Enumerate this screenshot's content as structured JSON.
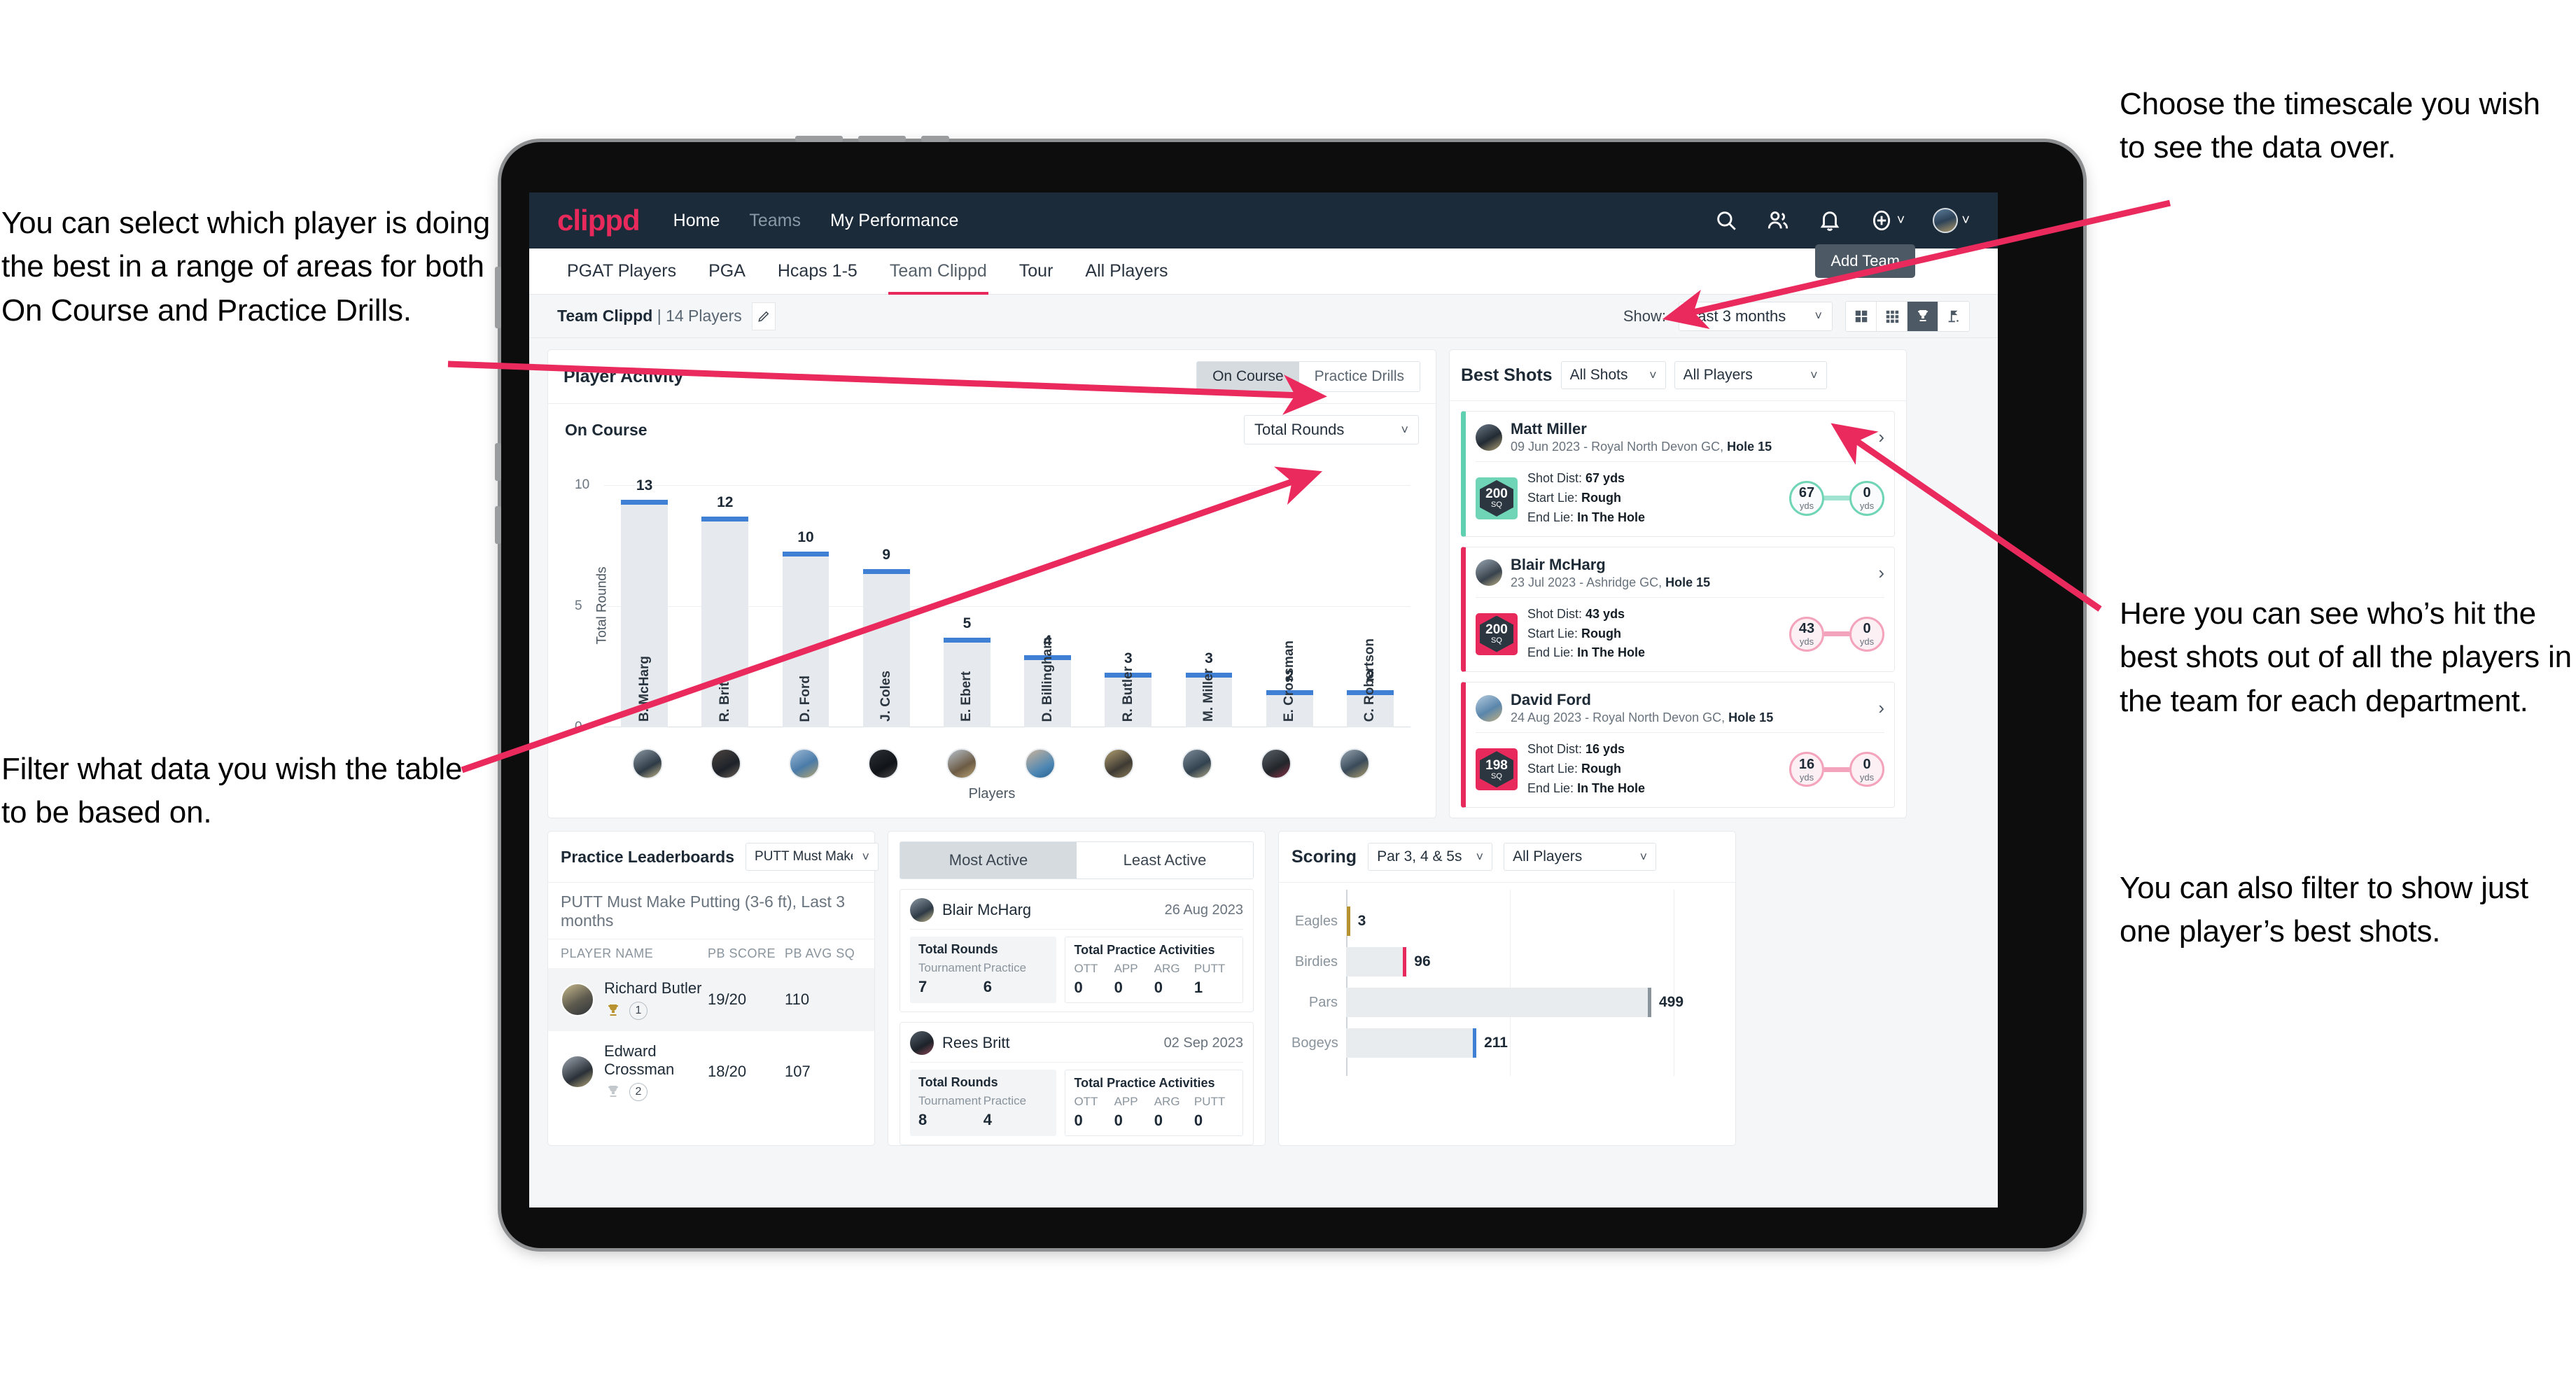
{
  "annotations": {
    "left_top": "You can select which player is doing the best in a range of areas for both On Course and Practice Drills.",
    "left_bottom": "Filter what data you wish the table to be based on.",
    "right_top": "Choose the timescale you wish to see the data over.",
    "right_middle": "Here you can see who’s hit the best shots out of all the players in the team for each department.",
    "right_bottom": "You can also filter to show just one player’s best shots."
  },
  "topnav": {
    "logo": "clippd",
    "links": [
      {
        "label": "Home",
        "active": true
      },
      {
        "label": "Teams",
        "active": false
      },
      {
        "label": "My Performance",
        "active": true
      }
    ],
    "icons": [
      "search-icon",
      "people-icon",
      "bell-icon",
      "plus-circle-icon",
      "avatar"
    ]
  },
  "tabs": [
    {
      "label": "PGAT Players",
      "active": false
    },
    {
      "label": "PGA",
      "active": false
    },
    {
      "label": "Hcaps 1-5",
      "active": false
    },
    {
      "label": "Team Clippd",
      "active": true
    },
    {
      "label": "Tour",
      "active": false
    },
    {
      "label": "All Players",
      "active": false
    }
  ],
  "tooltip": {
    "add_team": "Add Team"
  },
  "toolbar": {
    "team_name": "Team Clippd",
    "team_sep": " | ",
    "player_count": "14 Players",
    "edit_icon": "pencil-icon",
    "show_label": "Show:",
    "timescale_value": "Last 3 months",
    "views": [
      {
        "name": "grid-large-icon",
        "active": false
      },
      {
        "name": "grid-small-icon",
        "active": false
      },
      {
        "name": "trophy-icon",
        "active": true
      },
      {
        "name": "flag-icon",
        "active": false
      }
    ]
  },
  "player_activity": {
    "title": "Player Activity",
    "segments": [
      {
        "label": "On Course",
        "active": true
      },
      {
        "label": "Practice Drills",
        "active": false
      }
    ],
    "sub_label": "On Course",
    "metric_value": "Total Rounds"
  },
  "chart_data": [
    {
      "type": "bar",
      "title": "Player Activity – On Course",
      "categories": [
        "B. McHarg",
        "R. Britt",
        "D. Ford",
        "J. Coles",
        "E. Ebert",
        "D. Billingham",
        "R. Butler",
        "M. Miller",
        "E. Crossman",
        "C. Robertson"
      ],
      "values": [
        13,
        12,
        10,
        9,
        5,
        4,
        3,
        3,
        2,
        2
      ],
      "xlabel": "Players",
      "ylabel": "Total Rounds",
      "yticks": [
        0,
        5,
        10
      ],
      "ylim": [
        0,
        14
      ],
      "grid": true,
      "bar_color": "#e6e9ed",
      "cap_color": "#3f7fd4"
    },
    {
      "type": "bar",
      "orientation": "horizontal",
      "title": "Scoring",
      "categories": [
        "Eagles",
        "Birdies",
        "Pars",
        "Bogeys"
      ],
      "values": [
        3,
        96,
        499,
        211
      ],
      "colors": [
        "#b8922f",
        "#e8295b",
        "#8a949d",
        "#3f7fd4"
      ],
      "xlim": [
        0,
        620
      ],
      "grid": true
    }
  ],
  "best_shots": {
    "title": "Best Shots",
    "shot_filter": "All Shots",
    "player_filter": "All Players",
    "items": [
      {
        "player": "Matt Miller",
        "date": "09 Jun 2023",
        "course": "Royal North Devon GC,",
        "hole": "Hole 15",
        "sq": "200",
        "sq_unit": "SQ",
        "accent": "teal",
        "shot_dist_label": "Shot Dist:",
        "shot_dist": "67 yds",
        "start_lie_label": "Start Lie:",
        "start_lie": "Rough",
        "end_lie_label": "End Lie:",
        "end_lie": "In The Hole",
        "from_val": "67",
        "from_unit": "yds",
        "to_val": "0",
        "to_unit": "yds"
      },
      {
        "player": "Blair McHarg",
        "date": "23 Jul 2023",
        "course": "Ashridge GC,",
        "hole": "Hole 15",
        "sq": "200",
        "sq_unit": "SQ",
        "accent": "pink",
        "shot_dist_label": "Shot Dist:",
        "shot_dist": "43 yds",
        "start_lie_label": "Start Lie:",
        "start_lie": "Rough",
        "end_lie_label": "End Lie:",
        "end_lie": "In The Hole",
        "from_val": "43",
        "from_unit": "yds",
        "to_val": "0",
        "to_unit": "yds"
      },
      {
        "player": "David Ford",
        "date": "24 Aug 2023",
        "course": "Royal North Devon GC,",
        "hole": "Hole 15",
        "sq": "198",
        "sq_unit": "SQ",
        "accent": "pink",
        "shot_dist_label": "Shot Dist:",
        "shot_dist": "16 yds",
        "start_lie_label": "Start Lie:",
        "start_lie": "Rough",
        "end_lie_label": "End Lie:",
        "end_lie": "In The Hole",
        "from_val": "16",
        "from_unit": "yds",
        "to_val": "0",
        "to_unit": "yds"
      }
    ]
  },
  "practice_leaderboards": {
    "title": "Practice Leaderboards",
    "drill_select": "PUTT Must Make Putting ...",
    "subtitle_bold": "PUTT Must Make Putting (3-6 ft),",
    "subtitle_light": "Last 3 months",
    "columns": [
      "PLAYER NAME",
      "PB SCORE",
      "PB AVG SQ"
    ],
    "rows": [
      {
        "name": "Richard Butler",
        "rank": "1",
        "trophy": "gold",
        "pb_score": "19/20",
        "pb_avg_sq": "110"
      },
      {
        "name": "Edward Crossman",
        "rank": "2",
        "trophy": "silver",
        "pb_score": "18/20",
        "pb_avg_sq": "107"
      }
    ]
  },
  "activity": {
    "tabs": [
      {
        "label": "Most Active",
        "active": true
      },
      {
        "label": "Least Active",
        "active": false
      }
    ],
    "cards": [
      {
        "name": "Blair McHarg",
        "date": "26 Aug 2023",
        "rounds_title": "Total Rounds",
        "rounds": [
          {
            "k": "Tournament",
            "v": "7"
          },
          {
            "k": "Practice",
            "v": "6"
          }
        ],
        "practice_title": "Total Practice Activities",
        "practice": [
          {
            "k": "OTT",
            "v": "0"
          },
          {
            "k": "APP",
            "v": "0"
          },
          {
            "k": "ARG",
            "v": "0"
          },
          {
            "k": "PUTT",
            "v": "1"
          }
        ]
      },
      {
        "name": "Rees Britt",
        "date": "02 Sep 2023",
        "rounds_title": "Total Rounds",
        "rounds": [
          {
            "k": "Tournament",
            "v": "8"
          },
          {
            "k": "Practice",
            "v": "4"
          }
        ],
        "practice_title": "Total Practice Activities",
        "practice": [
          {
            "k": "OTT",
            "v": "0"
          },
          {
            "k": "APP",
            "v": "0"
          },
          {
            "k": "ARG",
            "v": "0"
          },
          {
            "k": "PUTT",
            "v": "0"
          }
        ]
      }
    ]
  },
  "scoring": {
    "title": "Scoring",
    "par_filter": "Par 3, 4 & 5s",
    "player_filter": "All Players"
  },
  "colors": {
    "brand_pink": "#e8295b",
    "nav_dark": "#1b2b3a",
    "blue_cap": "#3f7fd4",
    "teal": "#6fd5b6"
  }
}
